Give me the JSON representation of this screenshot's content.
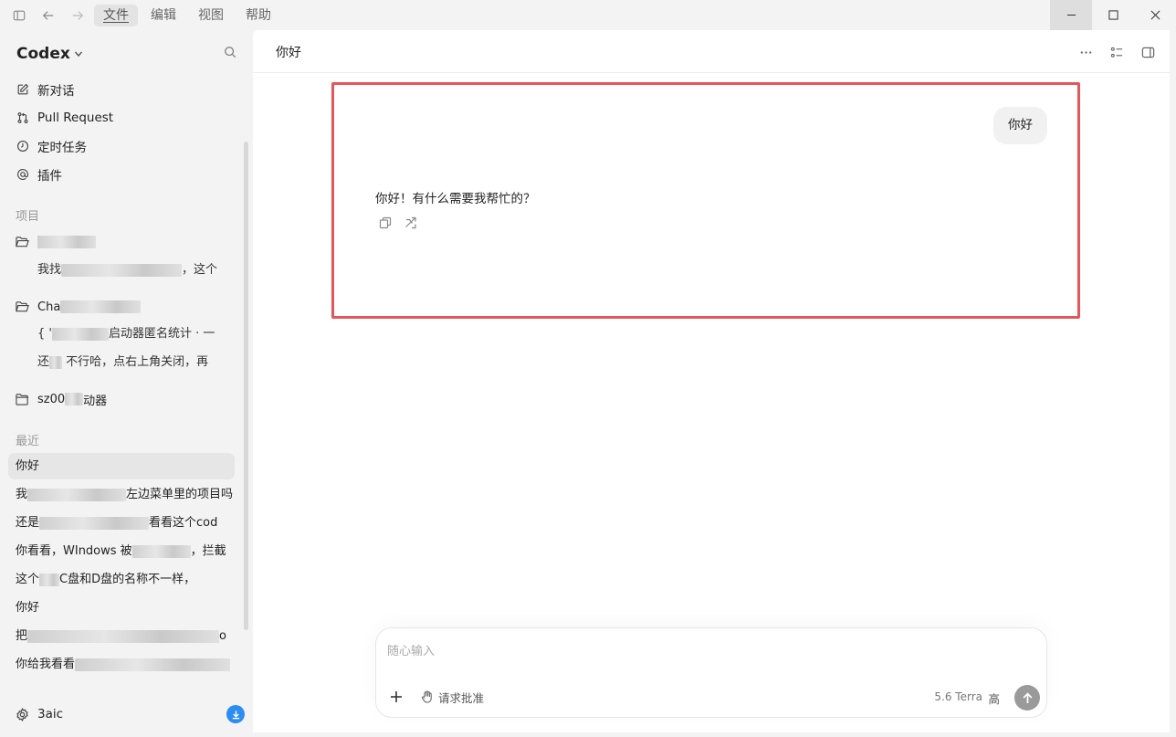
{
  "menu": {
    "items": [
      "文件",
      "编辑",
      "视图",
      "帮助"
    ]
  },
  "sidebar": {
    "title": "Codex",
    "nav": [
      "新对话",
      "Pull Request",
      "定时任务",
      "插件"
    ],
    "projects_label": "项目",
    "projects": [
      {
        "name_visible": "",
        "threads": [
          {
            "pre": "我找",
            "post": "，这个"
          }
        ]
      },
      {
        "name_visible": "Cha",
        "threads": [
          {
            "pre": "{ '",
            "post": "启动器匿名统计 · 一"
          },
          {
            "pre": "还",
            "post": " 不行哈，点右上角关闭，再"
          }
        ]
      },
      {
        "name_pre": "sz00",
        "name_post": "动器",
        "threads": []
      }
    ],
    "recent_label": "最近",
    "recent": [
      {
        "pre": "你好",
        "post": ""
      },
      {
        "pre": "我",
        "post": "左边菜单里的项目吗"
      },
      {
        "pre": "还是",
        "post": "看看这个cod"
      },
      {
        "pre": "你看看，WIndows 被",
        "post": "，拦截"
      },
      {
        "pre": "这个",
        "post": "C盘和D盘的名称不一样，"
      },
      {
        "pre": "你好",
        "post": ""
      },
      {
        "pre": "把",
        "post": "o"
      },
      {
        "pre": "你给我看看",
        "post": ""
      }
    ],
    "user": "3aic"
  },
  "main": {
    "title": "你好",
    "user_message": "你好",
    "assistant_message": "你好！有什么需要我帮忙的？"
  },
  "composer": {
    "placeholder": "随心输入",
    "approval_label": "请求批准",
    "model": "5.6 Terra",
    "effort": "高"
  }
}
